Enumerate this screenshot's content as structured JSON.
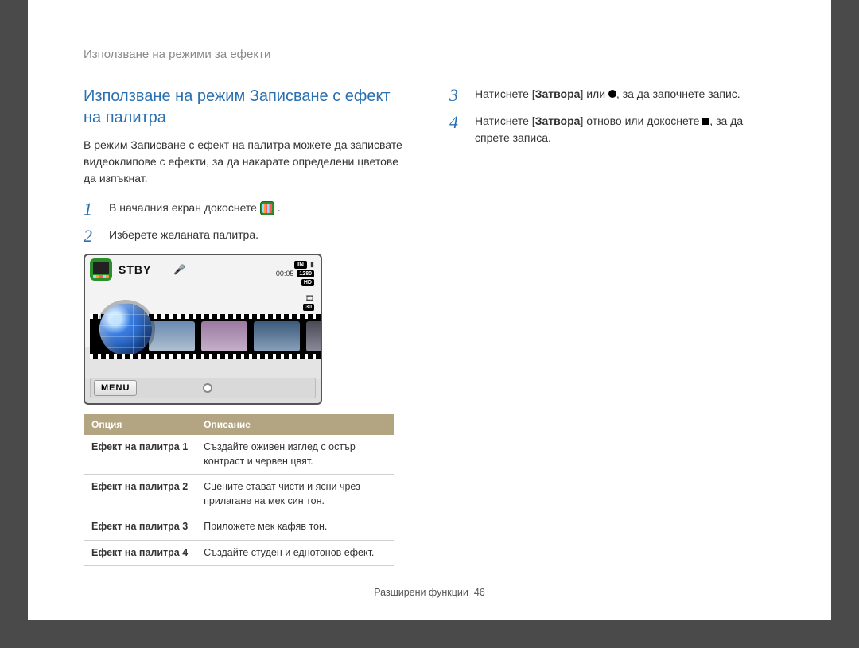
{
  "breadcrumb": "Използване на режими за ефекти",
  "section_title": "Използване на режим Записване с ефект на палитра",
  "intro": "В режим Записване с ефект на палитра можете да записвате видеоклипове с ефекти, за да накарате определени цветове да изпъкнат.",
  "left_steps": [
    {
      "num": "1",
      "text_before": "В началния екран докоснете ",
      "icon": "palette",
      "text_after": "."
    },
    {
      "num": "2",
      "text_before": "Изберете желаната палитра.",
      "icon": null,
      "text_after": ""
    }
  ],
  "right_steps": [
    {
      "num": "3",
      "pre": "Натиснете [",
      "bold": "Затвора",
      "mid": "] или ",
      "icon": "circle",
      "post": ", за да започнете запис."
    },
    {
      "num": "4",
      "pre": "Натиснете [",
      "bold": "Затвора",
      "mid": "] отново или докоснете ",
      "icon": "square",
      "post": ", за да спрете записа."
    }
  ],
  "camera": {
    "stby": "STBY",
    "time": "00:05",
    "badges": {
      "in": "IN",
      "res": "1280",
      "hd": "HD",
      "fps": "30"
    },
    "menu": "MENU"
  },
  "table": {
    "head": {
      "option": "Опция",
      "desc": "Описание"
    },
    "rows": [
      {
        "name": "Ефект на палитра 1",
        "desc": "Създайте оживен изглед с остър контраст и червен цвят."
      },
      {
        "name": "Ефект на палитра 2",
        "desc": "Сцените стават чисти и ясни чрез прилагане на мек син тон."
      },
      {
        "name": "Ефект на палитра 3",
        "desc": "Приложете мек кафяв тон."
      },
      {
        "name": "Ефект на палитра 4",
        "desc": "Създайте студен и еднотонов ефект."
      }
    ]
  },
  "footer": {
    "label": "Разширени функции",
    "page": "46"
  }
}
